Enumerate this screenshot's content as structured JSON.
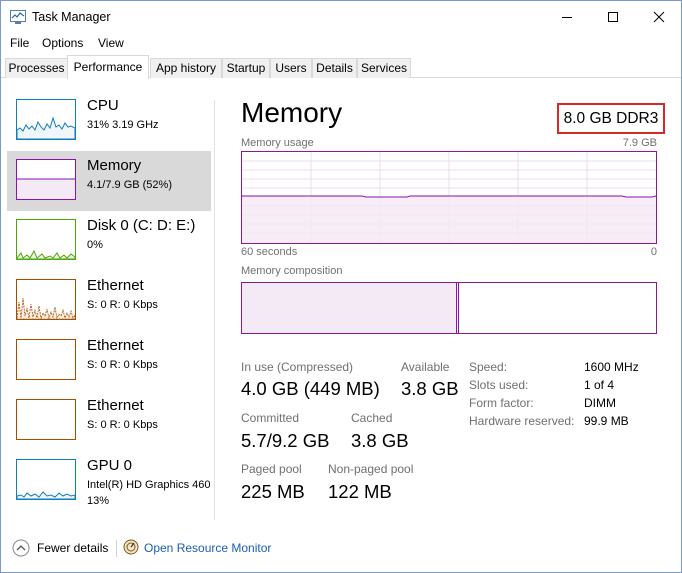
{
  "window": {
    "title": "Task Manager"
  },
  "menu": [
    "File",
    "Options",
    "View"
  ],
  "tabs": [
    "Processes",
    "Performance",
    "App history",
    "Startup",
    "Users",
    "Details",
    "Services"
  ],
  "sidebar": [
    {
      "title": "CPU",
      "line1": "31%  3.19 GHz",
      "color": "#117dbb"
    },
    {
      "title": "Memory",
      "line1": "4.1/7.9 GB (52%)",
      "color": "#8b12ae"
    },
    {
      "title": "Disk 0 (C: D: E:)",
      "line1": "0%",
      "color": "#4da60c"
    },
    {
      "title": "Ethernet",
      "line1": "S: 0 R: 0 Kbps",
      "color": "#a74f01"
    },
    {
      "title": "Ethernet",
      "line1": "S: 0 R: 0 Kbps",
      "color": "#a74f01"
    },
    {
      "title": "Ethernet",
      "line1": "S: 0 R: 0 Kbps",
      "color": "#a74f01"
    },
    {
      "title": "GPU 0",
      "line1": "Intel(R) HD Graphics 460",
      "line2": "13%",
      "color": "#117dbb"
    }
  ],
  "main": {
    "title": "Memory",
    "spec_badge": "8.0 GB DDR3",
    "usage_label": "Memory usage",
    "usage_max": "7.9 GB",
    "time_label": "60 seconds",
    "time_zero": "0",
    "composition_label": "Memory composition",
    "stats": {
      "in_use_label": "In use (Compressed)",
      "in_use_value": "4.0 GB (449 MB)",
      "available_label": "Available",
      "available_value": "3.8 GB",
      "committed_label": "Committed",
      "committed_value": "5.7/9.2 GB",
      "cached_label": "Cached",
      "cached_value": "3.8 GB",
      "paged_label": "Paged pool",
      "paged_value": "225 MB",
      "nonpaged_label": "Non-paged pool",
      "nonpaged_value": "122 MB"
    },
    "specs": {
      "speed_label": "Speed:",
      "speed_value": "1600 MHz",
      "slots_label": "Slots used:",
      "slots_value": "1 of 4",
      "form_label": "Form factor:",
      "form_value": "DIMM",
      "hw_label": "Hardware reserved:",
      "hw_value": "99.9 MB"
    },
    "accent_color": "#8b12ae"
  },
  "footer": {
    "fewer_details": "Fewer details",
    "open_resource_monitor": "Open Resource Monitor"
  }
}
